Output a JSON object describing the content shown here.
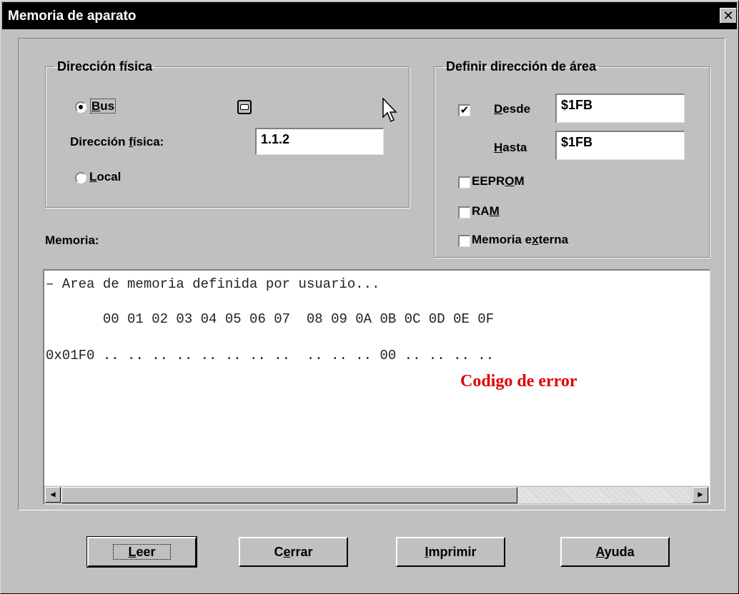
{
  "window": {
    "title": "Memoria de aparato",
    "close_glyph": "✕"
  },
  "physical_group": {
    "legend": "Dirección física",
    "bus_prefix": "",
    "bus_label_ul": "B",
    "bus_label_rest": "us",
    "address_label_pre": "Dirección ",
    "address_label_ul": "f",
    "address_label_post": "ísica:",
    "address_value": "1.1.2",
    "local_label_ul": "L",
    "local_label_rest": "ocal",
    "selected": "bus"
  },
  "area_group": {
    "legend": "Definir dirección de área",
    "desde_ul": "D",
    "desde_rest": "esde",
    "desde_value": "$1FB",
    "hasta_ul": "H",
    "hasta_rest": "asta",
    "hasta_value": "$1FB",
    "eeprom_pre": "EEPR",
    "eeprom_ul": "O",
    "eeprom_post": "M",
    "ram_pre": "RA",
    "ram_ul": "M",
    "ext_pre": "Memoria e",
    "ext_ul": "x",
    "ext_post": "terna",
    "desde_checked": "✔"
  },
  "memory": {
    "label": "Memoria:",
    "line1": "– Area de memoria definida por usuario...",
    "header": "       00 01 02 03 04 05 06 07  08 09 0A 0B 0C 0D 0E 0F",
    "row": "0x01F0 .. .. .. .. .. .. .. ..  .. .. .. 00 .. .. .. ..",
    "error_annotation": "Codigo de error"
  },
  "buttons": {
    "leer_ul": "L",
    "leer_rest": "eer",
    "cerrar_pre": "C",
    "cerrar_ul": "e",
    "cerrar_post": "rrar",
    "imprimir_ul": "I",
    "imprimir_rest": "mprimir",
    "ayuda_ul": "A",
    "ayuda_rest": "yuda"
  },
  "icons": {
    "left_arrow": "◀",
    "right_arrow": "▶",
    "serial": "serial-port-icon"
  }
}
